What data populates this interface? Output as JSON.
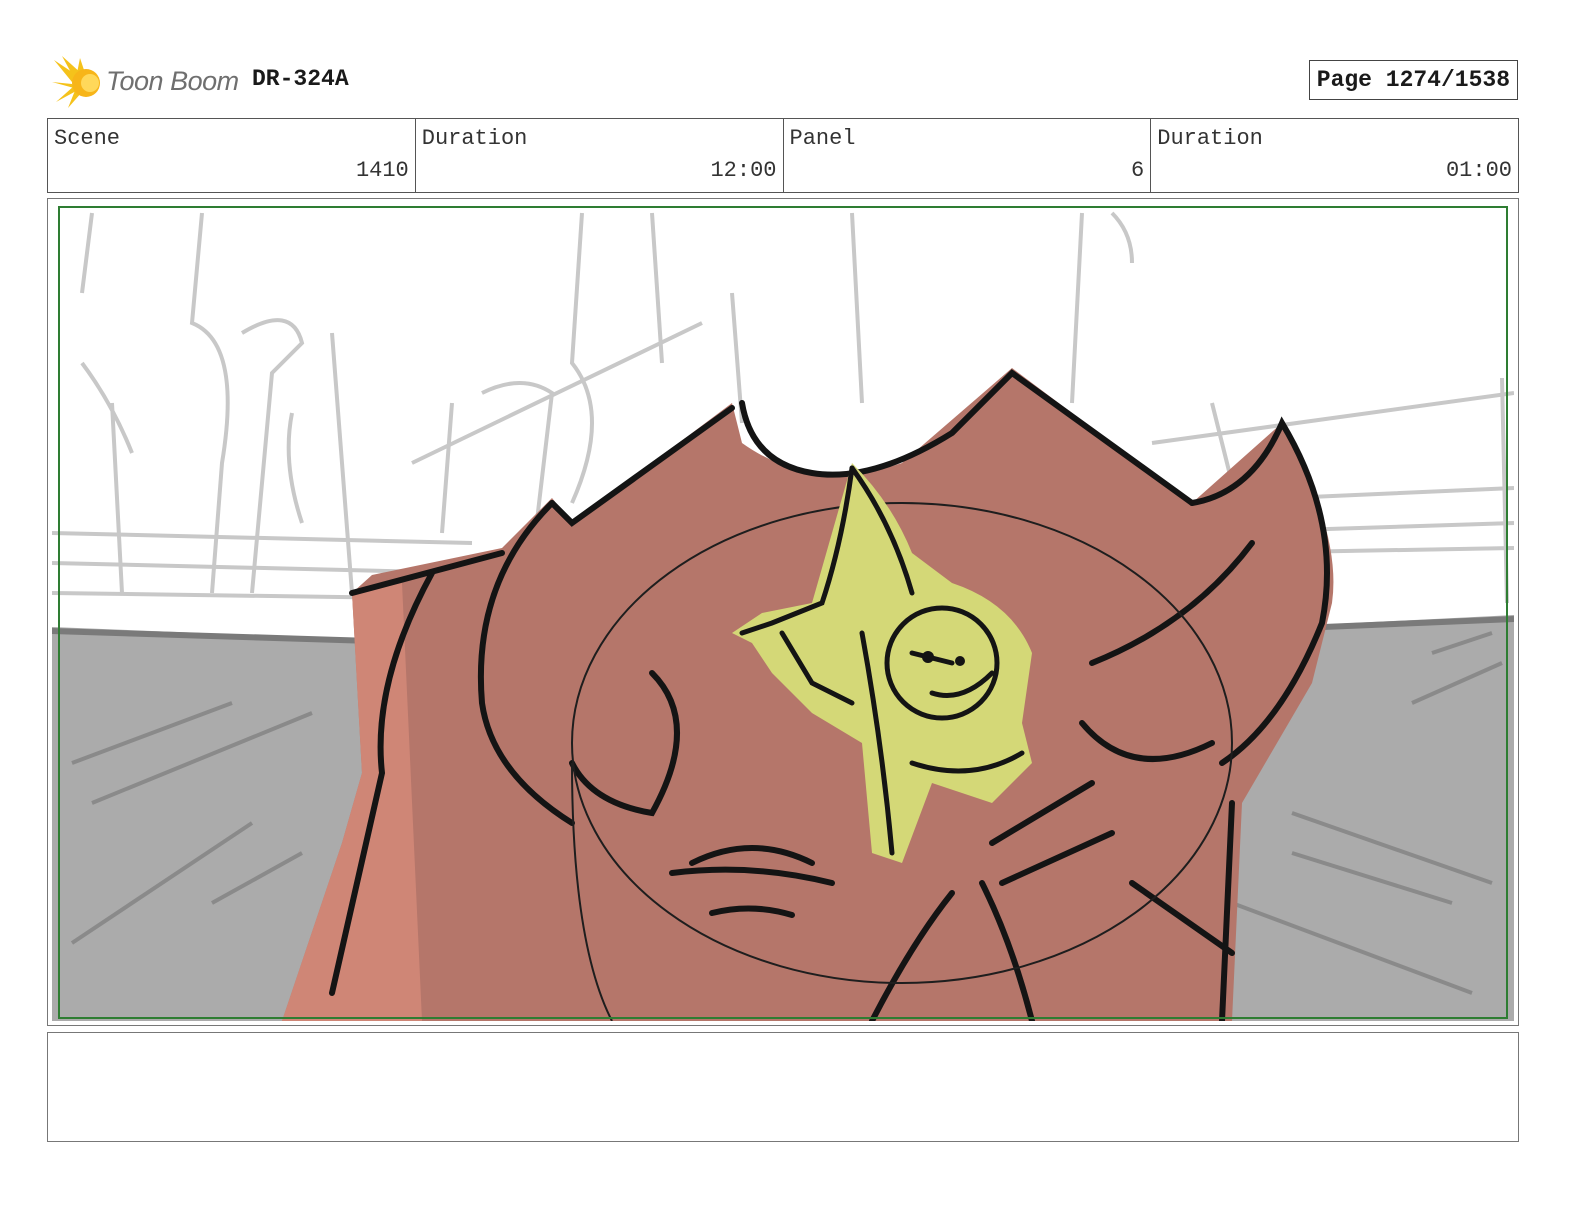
{
  "header": {
    "logo_text": "Toon Boom",
    "project_code": "DR-324A",
    "page_label": "Page 1274/1538"
  },
  "info": {
    "scene_label": "Scene",
    "scene_value": "1410",
    "scene_duration_label": "Duration",
    "scene_duration_value": "12:00",
    "panel_label": "Panel",
    "panel_value": "6",
    "panel_duration_label": "Duration",
    "panel_duration_value": "01:00"
  },
  "colors": {
    "safe_frame": "#2e7d32",
    "character_skin": "#b5766a",
    "small_character": "#d4d877",
    "floor": "#ababab"
  },
  "notes": {
    "text": ""
  }
}
